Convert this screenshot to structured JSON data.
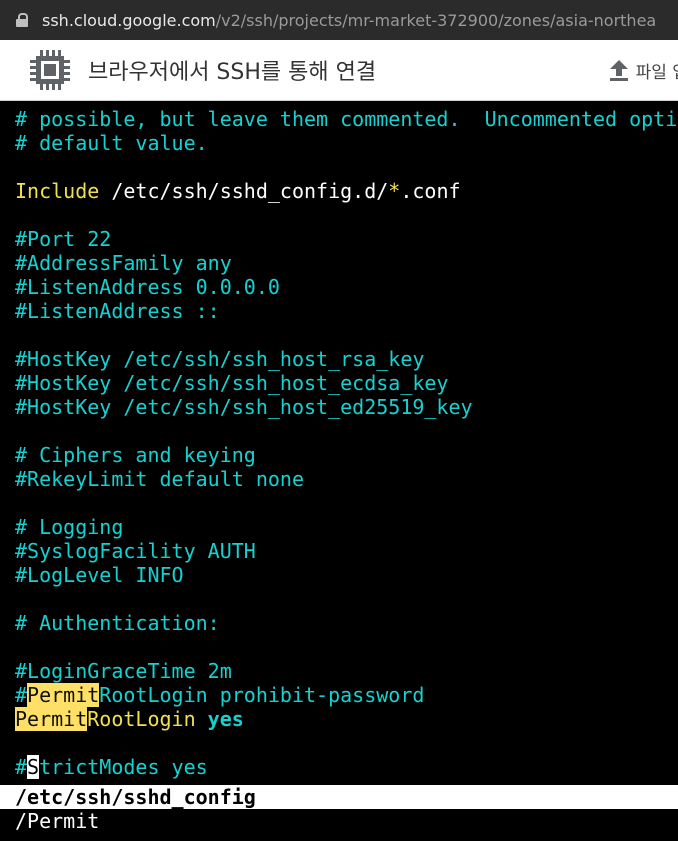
{
  "browser": {
    "url_host": "ssh.cloud.google.com",
    "url_path": "/v2/ssh/projects/mr-market-372900/zones/asia-northea"
  },
  "app": {
    "title": "브라우저에서 SSH를 통해 연결",
    "upload_label": "파일 업"
  },
  "terminal": {
    "l1": "# possible, but leave them commented.  Uncommented opti",
    "l2": "# default value.",
    "include_kw": "Include",
    "include_path_a": " /etc/ssh/sshd_config.d/",
    "include_star": "*",
    "include_path_b": ".conf",
    "port": "#Port 22",
    "addr_family": "#AddressFamily any",
    "listen1": "#ListenAddress 0.0.0.0",
    "listen2": "#ListenAddress ::",
    "hostkey_rsa": "#HostKey /etc/ssh/ssh_host_rsa_key",
    "hostkey_ecdsa": "#HostKey /etc/ssh/ssh_host_ecdsa_key",
    "hostkey_ed": "#HostKey /etc/ssh/ssh_host_ed25519_key",
    "ciphers": "# Ciphers and keying",
    "rekey": "#RekeyLimit default none",
    "logging": "# Logging",
    "syslog": "#SyslogFacility AUTH",
    "loglevel": "#LogLevel INFO",
    "auth": "# Authentication:",
    "grace": "#LoginGraceTime 2m",
    "hash": "#",
    "permit": "Permit",
    "rootlogin_rest_commented": "RootLogin prohibit-password",
    "rootlogin_rest": "RootLogin ",
    "yes": "yes",
    "strict_cursor_char": "S",
    "strict_rest": "trictModes yes",
    "status_filename": "/etc/ssh/sshd_config",
    "search_cmd": "/Permit"
  }
}
